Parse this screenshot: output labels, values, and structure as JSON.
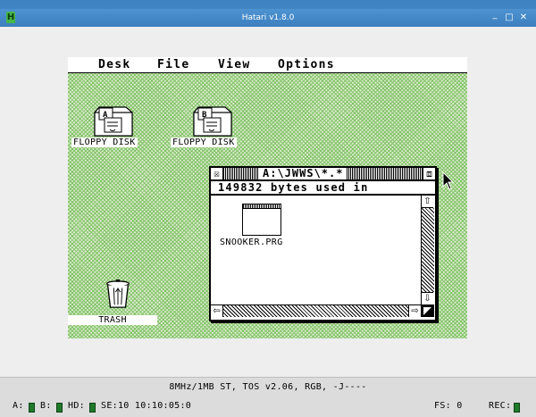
{
  "window": {
    "title": "Hatari v1.8.0",
    "app_icon_glyph": "H",
    "minimize_glyph": "_",
    "maximize_glyph": "□",
    "close_glyph": "✕"
  },
  "gem": {
    "menu": [
      "Desk",
      "File",
      "View",
      "Options"
    ],
    "desktop_icons": [
      {
        "label": "FLOPPY DISK",
        "drive": "A"
      },
      {
        "label": "FLOPPY DISK",
        "drive": "B"
      },
      {
        "label": "TRASH"
      }
    ],
    "window": {
      "title": "A:\\JWWS\\*.*",
      "info_line": "149832 bytes used in",
      "close_glyph": "☒",
      "full_glyph": "⧈",
      "files": [
        {
          "name": "SNOOKER.PRG"
        }
      ],
      "arrows": {
        "up": "⇧",
        "down": "⇩",
        "left": "⇦",
        "right": "⇨"
      }
    }
  },
  "status_bar": {
    "machine_info": "8MHz/1MB ST, TOS v2.06, RGB, -J----",
    "drive_a_label": "A:",
    "drive_b_label": "B:",
    "hd_label": "HD:",
    "timecode": "SE:10 10:10:05:0",
    "fs": "FS: 0",
    "rec_label": "REC:"
  },
  "colors": {
    "desktop_green": "#80c466",
    "led_green": "#1f7a2a",
    "titlebar_blue": "#3d7fbf"
  }
}
